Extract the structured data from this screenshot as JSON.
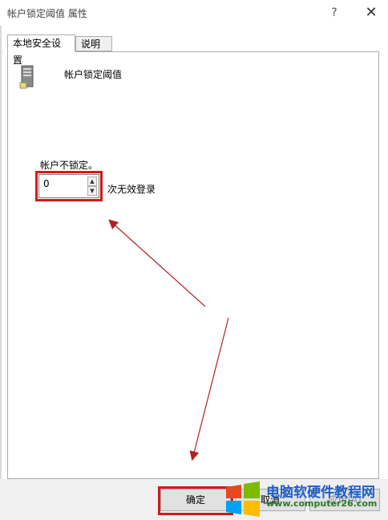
{
  "window": {
    "title": "帐户锁定阈值 属性",
    "help_label": "?",
    "close_label": "✕"
  },
  "tabs": [
    {
      "label": "本地安全设置",
      "active": true
    },
    {
      "label": "说明",
      "active": false
    }
  ],
  "policy": {
    "icon": "server-icon",
    "title": "帐户锁定阈值"
  },
  "setting": {
    "state_label": "帐户不锁定。",
    "value": "0",
    "unit_label": "次无效登录"
  },
  "buttons": {
    "ok": "确定",
    "cancel": "取消",
    "apply": "应用(A)"
  },
  "watermark": {
    "title": "电脑软硬件教程网",
    "url": "www.computer26.com"
  },
  "annotations": {
    "highlight_color": "#d01a1a",
    "arrow_color": "#b22222"
  }
}
